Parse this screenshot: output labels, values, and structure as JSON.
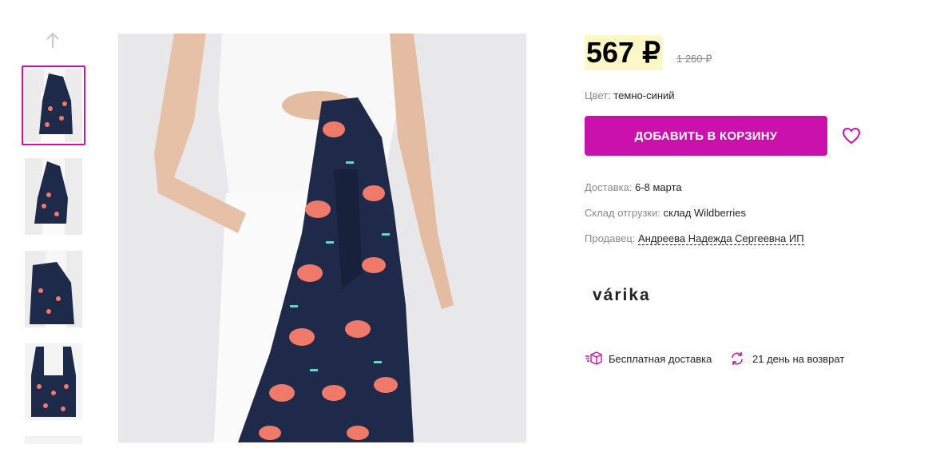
{
  "gallery": {
    "thumbnails": [
      {
        "label": "photo-1",
        "active": true
      },
      {
        "label": "photo-2",
        "active": false
      },
      {
        "label": "photo-3",
        "active": false
      },
      {
        "label": "photo-4",
        "active": false
      },
      {
        "label": "photo-5",
        "active": false
      }
    ]
  },
  "product": {
    "price": "567 ₽",
    "old_price": "1 260 ₽",
    "color_label": "Цвет:",
    "color_value": "темно-синий",
    "add_to_cart": "ДОБАВИТЬ В КОРЗИНУ",
    "delivery_label": "Доставка:",
    "delivery_value": "6-8 марта",
    "warehouse_label": "Склад отгрузки:",
    "warehouse_value": "склад Wildberries",
    "seller_label": "Продавец:",
    "seller_value": "Андреева Надежда Сергеевна ИП",
    "brand": "várika"
  },
  "perks": {
    "free_delivery": "Бесплатная доставка",
    "returns": "21 день на возврат"
  },
  "colors": {
    "accent": "#cb11ab",
    "price_highlight": "#fcf7c7",
    "bag": "#1e2a4a",
    "pattern": "#f07a6a"
  },
  "icons": [
    "arrow-up-icon",
    "heart-icon",
    "box-icon",
    "return-icon"
  ]
}
